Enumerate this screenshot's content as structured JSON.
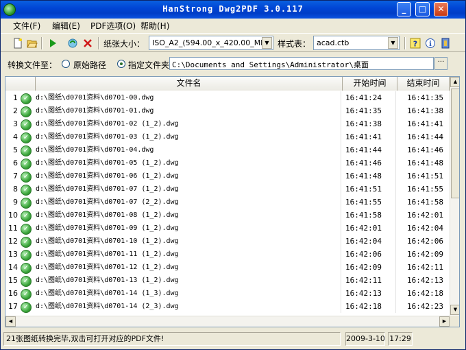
{
  "window": {
    "title": "HanStrong Dwg2PDF 3.0.117"
  },
  "menu": [
    "文件(F)",
    "编辑(E)",
    "PDF选项(O)",
    "帮助(H)"
  ],
  "toolbar": {
    "paper_label": "纸张大小：",
    "paper_value": "ISO_A2_(594.00_x_420.00_MM)",
    "style_label": "样式表：",
    "style_value": "acad.ctb"
  },
  "output": {
    "label": "转换文件至：",
    "option_original": "原始路径",
    "option_folder": "指定文件夹",
    "selected": "指定文件夹",
    "path": "C:\\Documents and Settings\\Administrator\\桌面"
  },
  "list": {
    "columns": [
      "文件名",
      "开始时间",
      "结束时间"
    ],
    "rows": [
      {
        "num": "1",
        "file": "d:\\图纸\\d0701资料\\d0701-00.dwg",
        "start": "16:41:24",
        "end": "16:41:35"
      },
      {
        "num": "2",
        "file": "d:\\图纸\\d0701资料\\d0701-01.dwg",
        "start": "16:41:35",
        "end": "16:41:38"
      },
      {
        "num": "3",
        "file": "d:\\图纸\\d0701资料\\d0701-02 (1_2).dwg",
        "start": "16:41:38",
        "end": "16:41:41"
      },
      {
        "num": "4",
        "file": "d:\\图纸\\d0701资料\\d0701-03 (1_2).dwg",
        "start": "16:41:41",
        "end": "16:41:44"
      },
      {
        "num": "5",
        "file": "d:\\图纸\\d0701资料\\d0701-04.dwg",
        "start": "16:41:44",
        "end": "16:41:46"
      },
      {
        "num": "6",
        "file": "d:\\图纸\\d0701资料\\d0701-05 (1_2).dwg",
        "start": "16:41:46",
        "end": "16:41:48"
      },
      {
        "num": "7",
        "file": "d:\\图纸\\d0701资料\\d0701-06 (1_2).dwg",
        "start": "16:41:48",
        "end": "16:41:51"
      },
      {
        "num": "8",
        "file": "d:\\图纸\\d0701资料\\d0701-07 (1_2).dwg",
        "start": "16:41:51",
        "end": "16:41:55"
      },
      {
        "num": "9",
        "file": "d:\\图纸\\d0701资料\\d0701-07 (2_2).dwg",
        "start": "16:41:55",
        "end": "16:41:58"
      },
      {
        "num": "10",
        "file": "d:\\图纸\\d0701资料\\d0701-08 (1_2).dwg",
        "start": "16:41:58",
        "end": "16:42:01"
      },
      {
        "num": "11",
        "file": "d:\\图纸\\d0701资料\\d0701-09 (1_2).dwg",
        "start": "16:42:01",
        "end": "16:42:04"
      },
      {
        "num": "12",
        "file": "d:\\图纸\\d0701资料\\d0701-10 (1_2).dwg",
        "start": "16:42:04",
        "end": "16:42:06"
      },
      {
        "num": "13",
        "file": "d:\\图纸\\d0701资料\\d0701-11 (1_2).dwg",
        "start": "16:42:06",
        "end": "16:42:09"
      },
      {
        "num": "14",
        "file": "d:\\图纸\\d0701资料\\d0701-12 (1_2).dwg",
        "start": "16:42:09",
        "end": "16:42:11"
      },
      {
        "num": "15",
        "file": "d:\\图纸\\d0701资料\\d0701-13 (1_2).dwg",
        "start": "16:42:11",
        "end": "16:42:13"
      },
      {
        "num": "16",
        "file": "d:\\图纸\\d0701资料\\d0701-14 (1_3).dwg",
        "start": "16:42:13",
        "end": "16:42:18"
      },
      {
        "num": "17",
        "file": "d:\\图纸\\d0701资料\\d0701-14 (2_3).dwg",
        "start": "16:42:18",
        "end": "16:42:23"
      }
    ]
  },
  "status": {
    "message": "21张图纸转换完毕,双击可打开对应的PDF文件!",
    "date": "2009-3-10",
    "time": "17:29"
  },
  "icons": [
    "app-icon",
    "new-file-icon",
    "open-folder-icon",
    "play-icon",
    "refresh-icon",
    "delete-icon",
    "help-icon",
    "info-icon",
    "exit-icon",
    "check-icon"
  ]
}
